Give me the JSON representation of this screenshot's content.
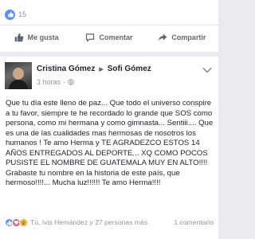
{
  "top_post": {
    "reaction_count": "15",
    "actions": {
      "like_label": "Me gusta",
      "comment_label": "Comentar",
      "share_label": "Compartir"
    }
  },
  "post": {
    "author": "Cristina Gómez",
    "recipient": "Sofi Gómez",
    "time": "3 horas",
    "privacy_icon": "globe-icon",
    "text": "Que tu día este lleno de paz... Que todo el universo conspire a tu favor, siempre te he recordado lo grande que SOS como persona, como mi hermana y como gimnasta... Sentiii.... Que es una de las cualidades mas hermosas de nosotros los humanos ! Te amo Herma y TE AGRADEZCO ESTOS 14 AÑOS ENTREGADOS AL DEPORTE... XQ COMO POCOS PUSISTE EL NOMBRE DE GUATEMALA MUY EN ALTO!!!! Grabaste tu nombre en la historia de este país, que hermoso!!!!... Mucha luz!!!!!! Te amo Herma!!!!",
    "reactions": {
      "icons": [
        "like-icon",
        "love-icon",
        "wow-icon"
      ],
      "summary": "Tú, Ivis Hernández y 27 personas más",
      "comments": "1 comentario"
    }
  },
  "colors": {
    "background": "#e9ebee",
    "facebook_blue": "#5890ff",
    "muted_text": "#90949c",
    "love_red": "#f25268",
    "wow_yellow": "#f7b125"
  }
}
